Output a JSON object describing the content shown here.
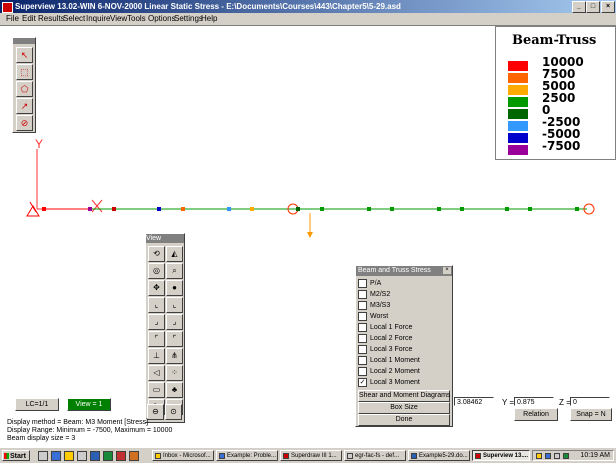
{
  "window": {
    "title": "Superview 13.02-WIN 6-NOV-2000 Linear Static Stress - E:\\Documents\\Courses\\443\\Chapter5\\5-29.asd",
    "minimize": "_",
    "maximize": "□",
    "close": "×"
  },
  "menu": [
    "File",
    "Edit",
    "Results",
    "Select",
    "Inquire",
    "View",
    "Tools",
    "Options",
    "Settings",
    "Help"
  ],
  "legend": {
    "title": "Beam-Truss",
    "entries": [
      {
        "value": "10000",
        "color": "#ff0000"
      },
      {
        "value": "7500",
        "color": "#ff6600"
      },
      {
        "value": "5000",
        "color": "#ffaa00"
      },
      {
        "value": "2500",
        "color": "#009900"
      },
      {
        "value": "0",
        "color": "#006600"
      },
      {
        "value": "-2500",
        "color": "#3399ff"
      },
      {
        "value": "-5000",
        "color": "#0000cc"
      },
      {
        "value": "-7500",
        "color": "#990099"
      }
    ]
  },
  "axes": {
    "y": "Y",
    "x": "X"
  },
  "view_toolbar": {
    "title": "View"
  },
  "beam_panel": {
    "title": "Beam and Truss Stress",
    "options": [
      {
        "label": "P/A",
        "checked": false
      },
      {
        "label": "M2/S2",
        "checked": false
      },
      {
        "label": "M3/S3",
        "checked": false
      },
      {
        "label": "Worst",
        "checked": false
      },
      {
        "label": "Local 1 Force",
        "checked": false
      },
      {
        "label": "Local 2 Force",
        "checked": false
      },
      {
        "label": "Local 3 Force",
        "checked": false
      },
      {
        "label": "Local 1 Moment",
        "checked": false
      },
      {
        "label": "Local 2 Moment",
        "checked": false
      },
      {
        "label": "Local 3 Moment",
        "checked": true
      }
    ],
    "buttons": [
      "Shear and Moment Diagrams",
      "Box Size",
      "Done"
    ]
  },
  "status": {
    "lc": "LC=1/1",
    "view": "View = 1",
    "info": [
      "Display method = Beam: M3 Moment  [Stress]",
      "Display Range: Minimum = -7500, Maximum = 10000",
      "Beam display size = 3"
    ]
  },
  "coords": {
    "x_value": "3.08462",
    "y_label": "Y =",
    "y_value": "0.875",
    "z_label": "Z =",
    "z_value": "0"
  },
  "bottom_buttons": {
    "relation": "Relation",
    "snap": "Snap = N"
  },
  "taskbar": {
    "start": "Start",
    "tasks": [
      "Inbox - Microsof...",
      "Example: Proble...",
      "Superdraw III 1...",
      "egr-fac-fs - def...",
      "Example5-29.do...",
      "Superview 13...."
    ],
    "clock": "10:19 AM"
  }
}
